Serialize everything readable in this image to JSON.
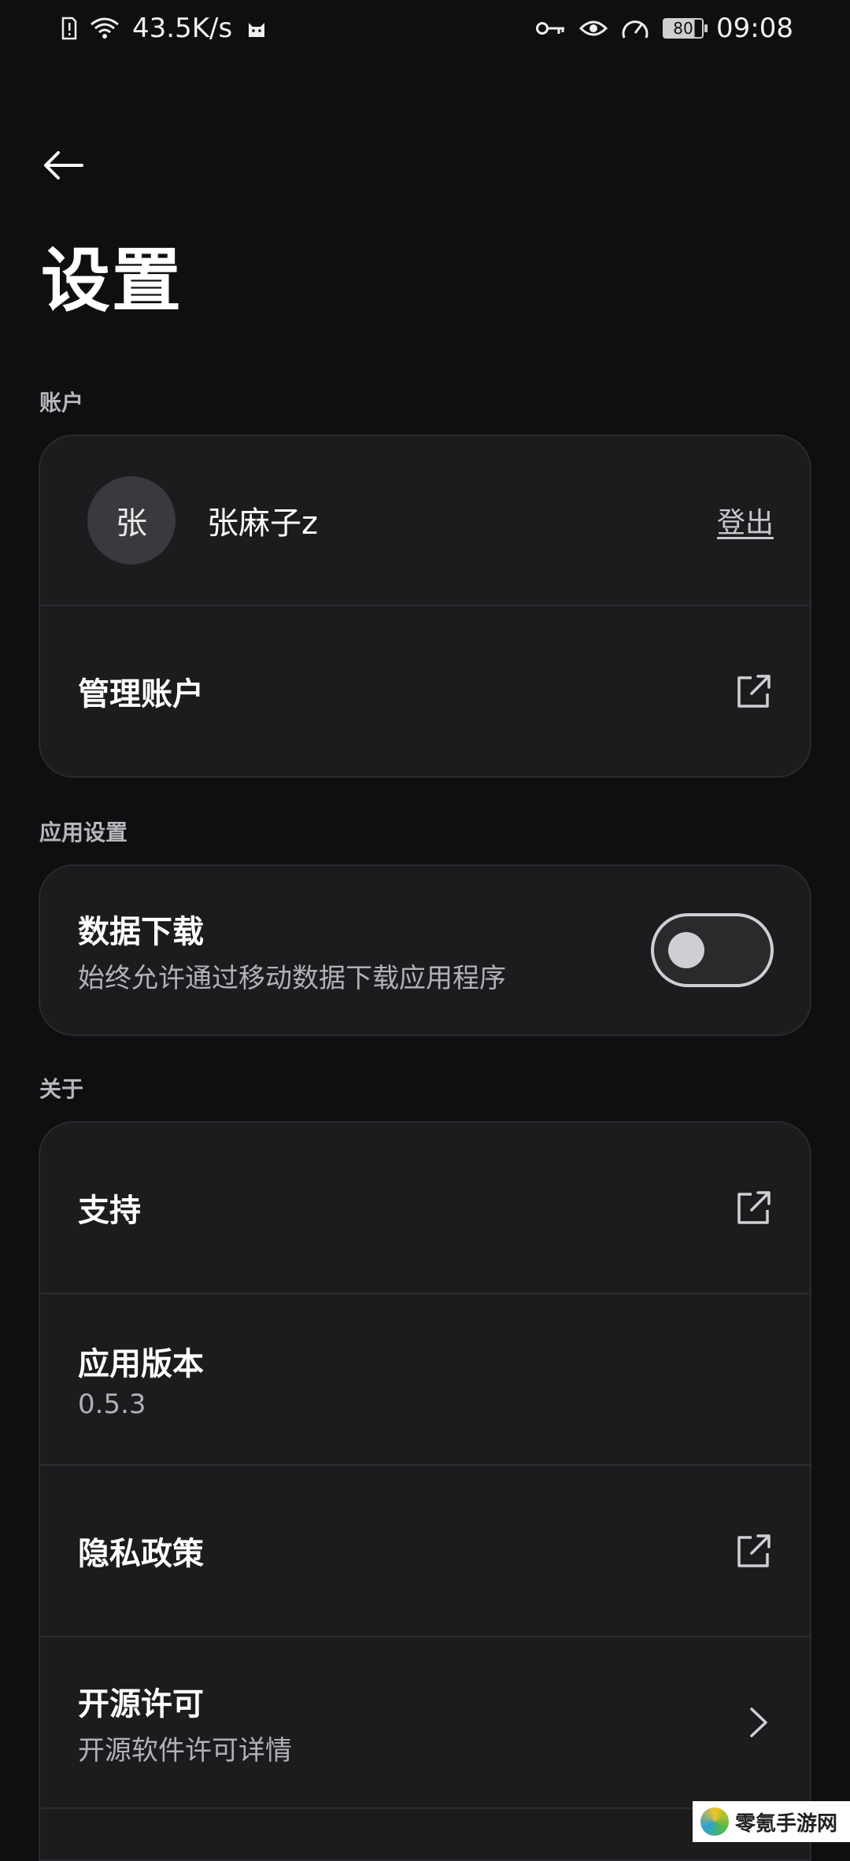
{
  "status_bar": {
    "net_speed": "43.5K/s",
    "battery": "80",
    "time": "09:08",
    "icons_left": [
      "sim-alert-icon",
      "wifi-icon",
      "cat-icon"
    ],
    "icons_right": [
      "key-icon",
      "eye-icon",
      "speedometer-icon",
      "battery-icon"
    ]
  },
  "header": {
    "back_icon": "back-arrow-icon",
    "title": "设置"
  },
  "sections": {
    "account": {
      "label": "账户",
      "avatar_letter": "张",
      "username": "张麻子z",
      "logout": "登出",
      "manage": "管理账户",
      "manage_icon": "external-link-icon"
    },
    "app_settings": {
      "label": "应用设置",
      "data_download": {
        "title": "数据下载",
        "subtitle": "始终允许通过移动数据下载应用程序",
        "enabled": false
      }
    },
    "about": {
      "label": "关于",
      "support": "支持",
      "version_title": "应用版本",
      "version_value": "0.5.3",
      "privacy": "隐私政策",
      "oss_title": "开源许可",
      "oss_subtitle": "开源软件许可详情"
    }
  },
  "watermark": {
    "text": "零氪手游网"
  }
}
